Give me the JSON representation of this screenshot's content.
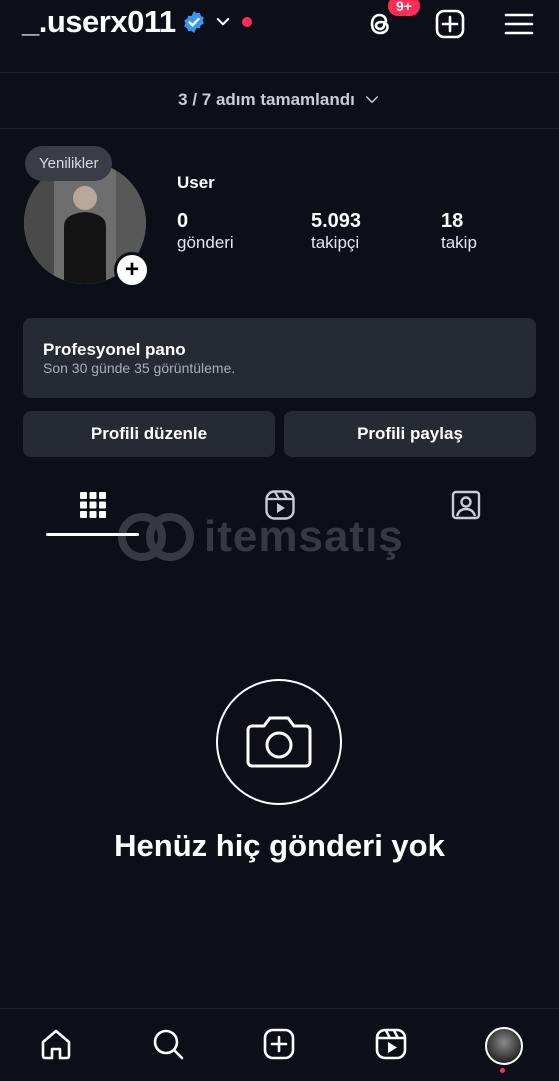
{
  "header": {
    "username": "_.userx011",
    "threads_badge": "9+"
  },
  "progress": {
    "text": "3 / 7 adım tamamlandı"
  },
  "profile": {
    "bubble": "Yenilikler",
    "name": "User",
    "stats": [
      {
        "value": "0",
        "label": "gönderi"
      },
      {
        "value": "5.093",
        "label": "takipçi"
      },
      {
        "value": "18",
        "label": "takip"
      }
    ]
  },
  "dashboard": {
    "title": "Profesyonel pano",
    "subtitle": "Son 30 günde 35 görüntüleme."
  },
  "buttons": {
    "edit": "Profili düzenle",
    "share": "Profili paylaş"
  },
  "watermark": {
    "text": "itemsatış"
  },
  "empty": {
    "text": "Henüz hiç gönderi yok"
  },
  "colors": {
    "accent_red": "#ff2d55",
    "verified_blue": "#3897f0",
    "card_bg": "#262a34"
  },
  "icons": [
    "threads-icon",
    "new-post-icon",
    "menu-icon",
    "grid-icon",
    "reels-icon",
    "tagged-icon",
    "camera-icon",
    "home-icon",
    "search-icon",
    "create-icon",
    "reels-nav-icon"
  ]
}
